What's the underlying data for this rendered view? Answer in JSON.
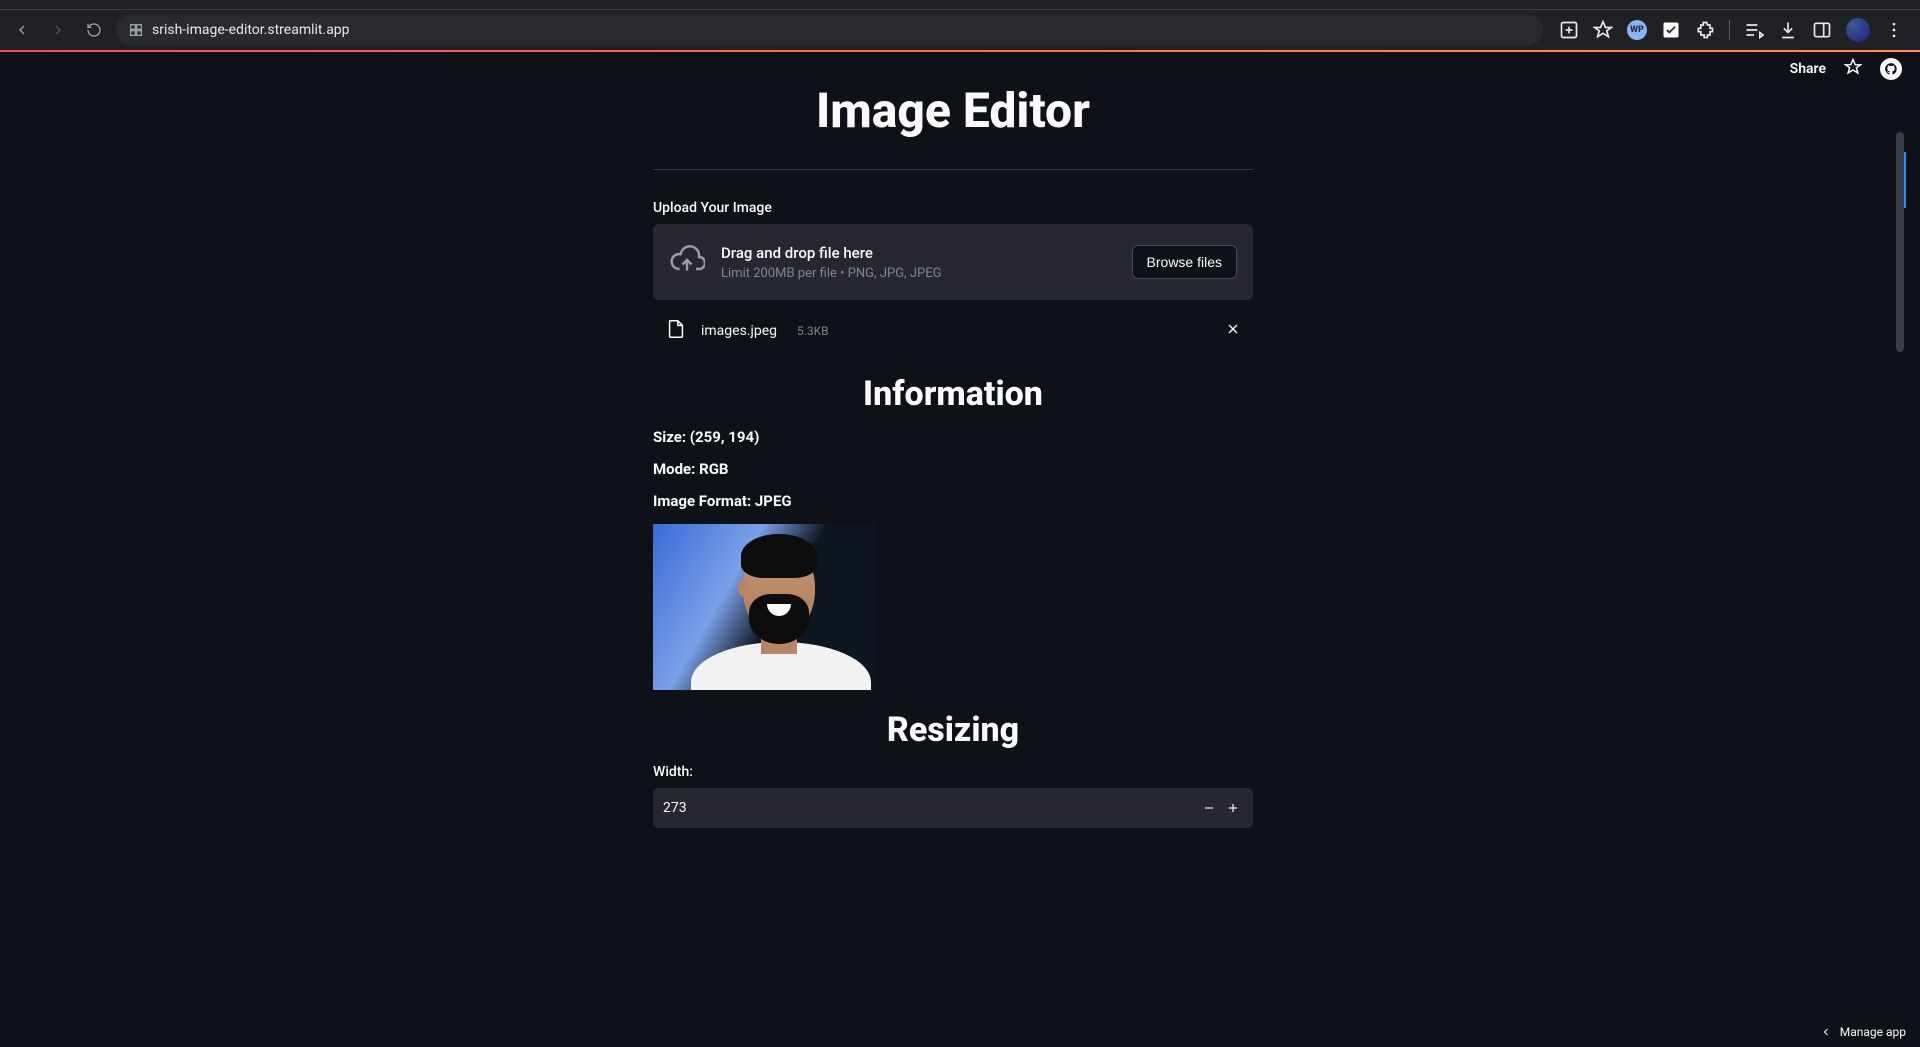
{
  "browser": {
    "url": "srish-image-editor.streamlit.app"
  },
  "header": {
    "share": "Share"
  },
  "page": {
    "title": "Image Editor",
    "upload_label": "Upload Your Image",
    "dropzone_main": "Drag and drop file here",
    "dropzone_sub": "Limit 200MB per file • PNG, JPG, JPEG",
    "browse_button": "Browse files"
  },
  "file": {
    "name": "images.jpeg",
    "size": "5.3KB"
  },
  "info": {
    "heading": "Information",
    "size_line": "Size: (259, 194)",
    "mode_line": "Mode: RGB",
    "format_line": "Image Format: JPEG"
  },
  "resize": {
    "heading": "Resizing",
    "width_label": "Width:",
    "width_value": "273"
  },
  "footer": {
    "manage": "Manage app"
  }
}
